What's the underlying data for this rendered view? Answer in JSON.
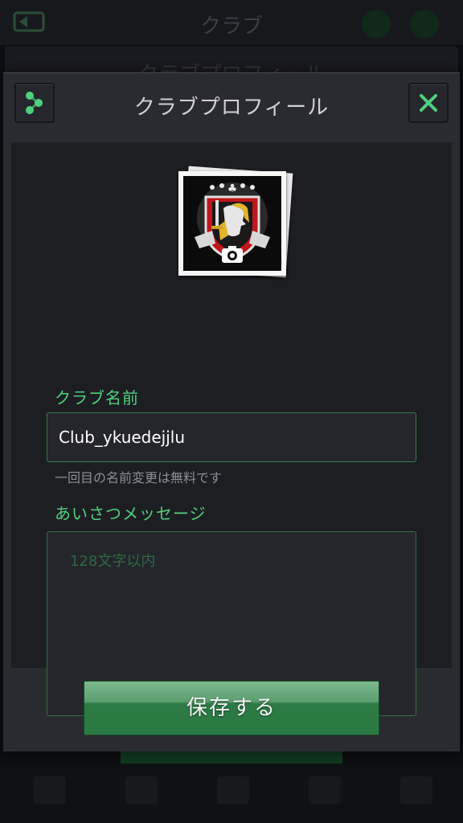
{
  "background": {
    "title": "クラブ",
    "subtitle": "クラブプロフィール"
  },
  "modal": {
    "title": "クラブプロフィール",
    "share_icon": "share-icon",
    "close_icon": "close-icon"
  },
  "avatar": {
    "icon": "club-emblem-jack-card",
    "camera_icon": "camera-icon"
  },
  "club_name": {
    "label": "クラブ名前",
    "value": "Club_ykuedejjlu",
    "hint": "一回目の名前変更は無料です"
  },
  "greeting": {
    "label": "あいさつメッセージ",
    "placeholder": "128文字以内"
  },
  "save_button": {
    "label": "保存する"
  },
  "colors": {
    "accent": "#4fd07e",
    "button_green": "#2a7a43",
    "modal_bg": "#2a2b31",
    "content_bg": "#1d1e22"
  }
}
